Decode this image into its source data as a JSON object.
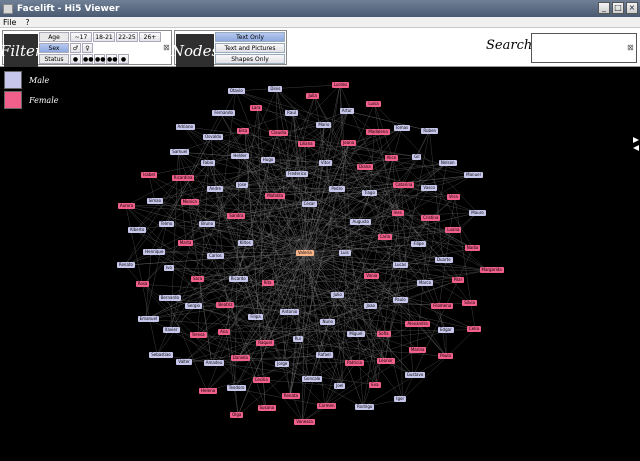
{
  "window": {
    "title": "Facelift - Hi5 Viewer",
    "controls": [
      "_",
      "□",
      "×"
    ]
  },
  "menu": [
    "File",
    "?"
  ],
  "filter": {
    "label": "Filter",
    "age_label": "Age",
    "age_options": [
      "~17",
      "18-21",
      "22-25",
      "26+"
    ],
    "sex_label": "Sex",
    "sex_options": [
      "♂",
      "♀"
    ],
    "status_label": "Status",
    "clear": "⊠"
  },
  "nodes_panel": {
    "label": "Nodes",
    "options": [
      "Text Only",
      "Text and Pictures",
      "Shapes Only"
    ],
    "selected": "Text Only"
  },
  "search": {
    "label": "Search",
    "value": "",
    "clear": "⊠"
  },
  "legend": [
    {
      "label": "Male",
      "color": "#c7c7ec"
    },
    {
      "label": "Female",
      "color": "#f0608a"
    }
  ],
  "colors": {
    "male": "#c7c7ec",
    "female": "#f0608a",
    "center": "#f9b48a",
    "edges": "#7a7a7a"
  },
  "graph": {
    "center": "Valeria",
    "nodes": [
      {
        "name": "Luis",
        "g": "m"
      },
      {
        "name": "Rita",
        "g": "f"
      },
      {
        "name": "Cesar",
        "g": "m"
      },
      {
        "name": "Julio",
        "g": "m"
      },
      {
        "name": "Klitos",
        "g": "m"
      },
      {
        "name": "Augusto",
        "g": "m"
      },
      {
        "name": "Antonio",
        "g": "m"
      },
      {
        "name": "Mafalda",
        "g": "f"
      },
      {
        "name": "Vania",
        "g": "f"
      },
      {
        "name": "Ricardo",
        "g": "m"
      },
      {
        "name": "Pedro",
        "g": "m"
      },
      {
        "name": "Nuno",
        "g": "m"
      },
      {
        "name": "Sandra",
        "g": "f"
      },
      {
        "name": "Carla",
        "g": "f"
      },
      {
        "name": "Filipa",
        "g": "m"
      },
      {
        "name": "Frederico",
        "g": "m"
      },
      {
        "name": "Joao",
        "g": "m"
      },
      {
        "name": "Carlos",
        "g": "m"
      },
      {
        "name": "Tiago",
        "g": "m"
      },
      {
        "name": "Rui",
        "g": "m"
      },
      {
        "name": "Jose",
        "g": "m"
      },
      {
        "name": "Lucas",
        "g": "m"
      },
      {
        "name": "Beatriz",
        "g": "f"
      },
      {
        "name": "Vitor",
        "g": "m"
      },
      {
        "name": "Miguel",
        "g": "m"
      },
      {
        "name": "Bruno",
        "g": "m"
      },
      {
        "name": "Ines",
        "g": "f"
      },
      {
        "name": "Raquel",
        "g": "f"
      },
      {
        "name": "Hugo",
        "g": "m"
      },
      {
        "name": "Paulo",
        "g": "m"
      },
      {
        "name": "Sara",
        "g": "f"
      },
      {
        "name": "Diana",
        "g": "f"
      },
      {
        "name": "Rafael",
        "g": "m"
      },
      {
        "name": "Andre",
        "g": "m"
      },
      {
        "name": "Filipe",
        "g": "m"
      },
      {
        "name": "Ana",
        "g": "f"
      },
      {
        "name": "Liliana",
        "g": "f"
      },
      {
        "name": "Sofia",
        "g": "f"
      },
      {
        "name": "Marta",
        "g": "f"
      },
      {
        "name": "Catarina",
        "g": "f"
      },
      {
        "name": "Jorge",
        "g": "m"
      },
      {
        "name": "Helder",
        "g": "m"
      },
      {
        "name": "Marco",
        "g": "m"
      },
      {
        "name": "Sergio",
        "g": "m"
      },
      {
        "name": "Joana",
        "g": "f"
      },
      {
        "name": "Patricia",
        "g": "f"
      },
      {
        "name": "Monica",
        "g": "f"
      },
      {
        "name": "Cristina",
        "g": "f"
      },
      {
        "name": "Daniela",
        "g": "f"
      },
      {
        "name": "Claudia",
        "g": "f"
      },
      {
        "name": "Alexandra",
        "g": "f"
      },
      {
        "name": "Ivo",
        "g": "m"
      },
      {
        "name": "Alice",
        "g": "f"
      },
      {
        "name": "Goncalo",
        "g": "m"
      },
      {
        "name": "Fabio",
        "g": "m"
      },
      {
        "name": "Duarte",
        "g": "m"
      },
      {
        "name": "Teresa",
        "g": "f"
      },
      {
        "name": "Mario",
        "g": "m"
      },
      {
        "name": "Leonor",
        "g": "f"
      },
      {
        "name": "Telmo",
        "g": "m"
      },
      {
        "name": "Vasco",
        "g": "m"
      },
      {
        "name": "Cecilia",
        "g": "f"
      },
      {
        "name": "Elsa",
        "g": "f"
      },
      {
        "name": "Filomena",
        "g": "f"
      },
      {
        "name": "Bernardo",
        "g": "m"
      },
      {
        "name": "Madalena",
        "g": "f"
      },
      {
        "name": "Joel",
        "g": "m"
      },
      {
        "name": "Ricardina",
        "g": "f"
      },
      {
        "name": "Luana",
        "g": "f"
      },
      {
        "name": "Amadeu",
        "g": "m"
      },
      {
        "name": "Raul",
        "g": "m"
      },
      {
        "name": "Marina",
        "g": "f"
      },
      {
        "name": "Henrique",
        "g": "m"
      },
      {
        "name": "Gil",
        "g": "m"
      },
      {
        "name": "Renata",
        "g": "f"
      },
      {
        "name": "Osvaldo",
        "g": "m"
      },
      {
        "name": "Pilar",
        "g": "f"
      },
      {
        "name": "Xavier",
        "g": "m"
      },
      {
        "name": "Artur",
        "g": "m"
      },
      {
        "name": "Eva",
        "g": "f"
      },
      {
        "name": "Simao",
        "g": "m"
      },
      {
        "name": "Vera",
        "g": "f"
      },
      {
        "name": "Teodoro",
        "g": "m"
      },
      {
        "name": "Lara",
        "g": "f"
      },
      {
        "name": "Edgar",
        "g": "m"
      },
      {
        "name": "Rosa",
        "g": "f"
      },
      {
        "name": "Tomas",
        "g": "m"
      },
      {
        "name": "Carmen",
        "g": "f"
      },
      {
        "name": "Samuel",
        "g": "m"
      },
      {
        "name": "Nadia",
        "g": "f"
      },
      {
        "name": "Valter",
        "g": "m"
      },
      {
        "name": "Julia",
        "g": "f"
      },
      {
        "name": "Gustavo",
        "g": "m"
      },
      {
        "name": "Alberto",
        "g": "m"
      },
      {
        "name": "Nelson",
        "g": "m"
      },
      {
        "name": "Susana",
        "g": "f"
      },
      {
        "name": "Fernando",
        "g": "m"
      },
      {
        "name": "Silvia",
        "g": "f"
      },
      {
        "name": "Emanuel",
        "g": "m"
      },
      {
        "name": "Luisa",
        "g": "f"
      },
      {
        "name": "Rodrigo",
        "g": "m"
      },
      {
        "name": "Isabel",
        "g": "f"
      },
      {
        "name": "Mauro",
        "g": "m"
      },
      {
        "name": "Helena",
        "g": "f"
      },
      {
        "name": "Dinis",
        "g": "m"
      },
      {
        "name": "Paula",
        "g": "f"
      },
      {
        "name": "Renato",
        "g": "m"
      },
      {
        "name": "Ruben",
        "g": "m"
      },
      {
        "name": "Vanessa",
        "g": "f"
      },
      {
        "name": "Adriano",
        "g": "m"
      },
      {
        "name": "Margarida",
        "g": "f"
      },
      {
        "name": "Sebastiao",
        "g": "m"
      },
      {
        "name": "Lurdes",
        "g": "f"
      },
      {
        "name": "Igor",
        "g": "m"
      },
      {
        "name": "Aurora",
        "g": "f"
      },
      {
        "name": "Manuel",
        "g": "m"
      },
      {
        "name": "Olga",
        "g": "f"
      },
      {
        "name": "Otavio",
        "g": "m"
      },
      {
        "name": "Celia",
        "g": "f"
      }
    ]
  }
}
